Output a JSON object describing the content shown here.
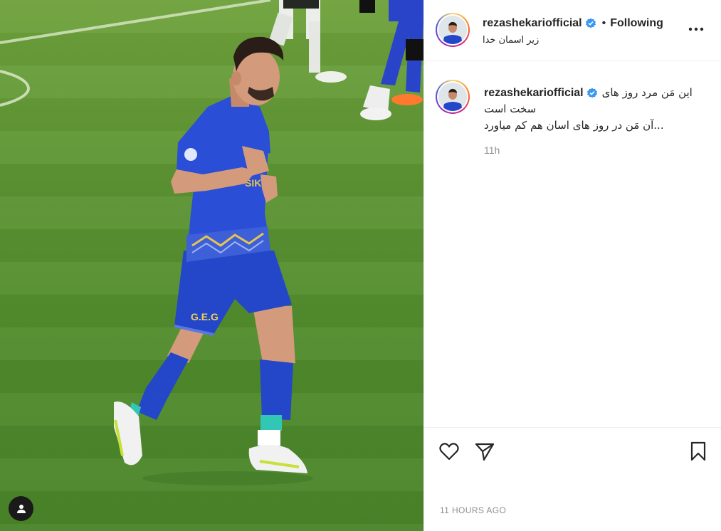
{
  "post": {
    "username": "rezashekariofficial",
    "follow_status": "Following",
    "separator": "•",
    "location": "زیر اسمان خدا",
    "caption_line1": "این مَن مرد روز های",
    "caption_line2": "سخت است",
    "caption_line3": "...آن مَن در روز های اسان هم کم میاورد",
    "relative_time": "11h",
    "absolute_time": "11 HOURS AGO"
  },
  "photo": {
    "jersey_text": "SIKA",
    "shorts_text": "G.E.G"
  },
  "icons": {
    "verified": "verified-badge-icon",
    "more": "more-options-icon",
    "like": "heart-icon",
    "share": "paper-plane-icon",
    "save": "bookmark-icon",
    "tags": "user-tag-icon"
  },
  "colors": {
    "verified_blue": "#3897f0",
    "muted_text": "#8e8e8e",
    "primary_text": "#262626",
    "jersey_blue": "#2347c8"
  }
}
